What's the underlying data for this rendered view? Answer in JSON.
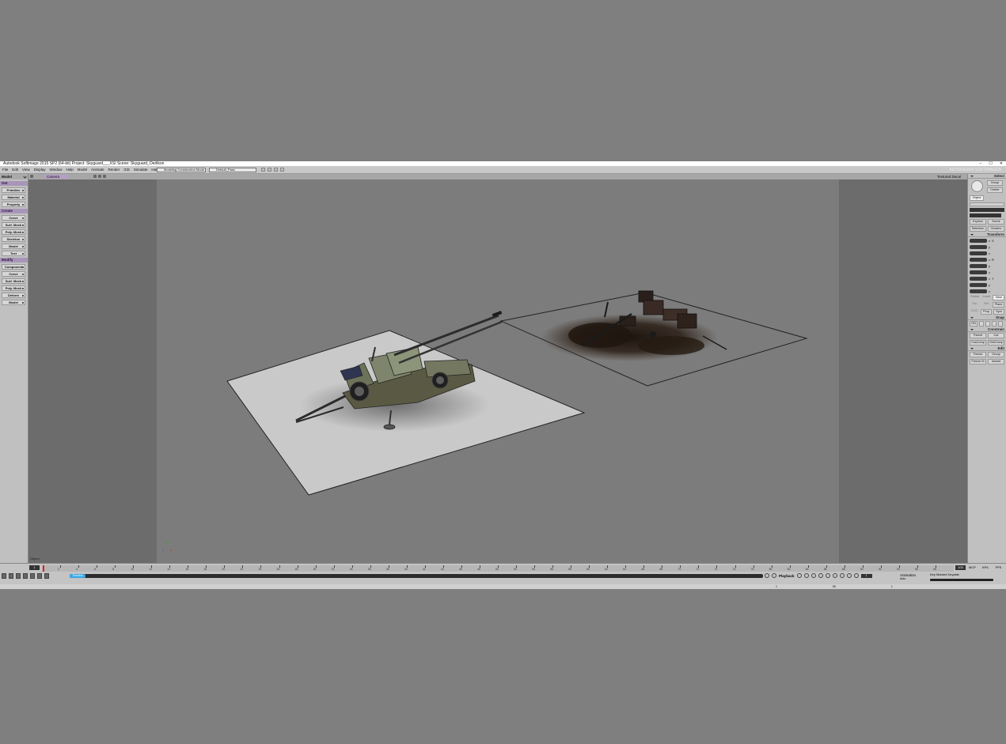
{
  "window": {
    "title": "Autodesk Softimage 2015 SP2 (64-bit)    Project: Skyguard___XSI    Scene: Skyguard_Oerlikon",
    "controls": [
      "–",
      "☐",
      "✕"
    ]
  },
  "menubar": {
    "menus": [
      "File",
      "Edit",
      "View",
      "Display",
      "Window",
      "Help",
      "Model",
      "Animate",
      "Render",
      "ICE",
      "Simulate",
      "Hair",
      "Face Robot"
    ],
    "construction_mode": "Modeling Construction Mode",
    "pass": "Default_Pass",
    "brand": "AUTODESK® SOFTIMAGE®"
  },
  "left_panel": {
    "module": "Model",
    "sections": [
      {
        "title": "Get",
        "buttons": [
          "Primitive",
          "Material",
          "Property"
        ]
      },
      {
        "title": "Create",
        "buttons": [
          "Curve",
          "Surf. Mesh",
          "Poly. Mesh",
          "Skeleton",
          "Model",
          "Text"
        ]
      },
      {
        "title": "Modify",
        "buttons": [
          "Component",
          "Curve",
          "Surf. Mesh",
          "Poly. Mesh",
          "Deform",
          "Model"
        ]
      }
    ]
  },
  "viewport": {
    "camera": "Camera",
    "shading": "Textured Decal",
    "axis": {
      "x": "x",
      "y": "y",
      "z": "z"
    },
    "bottom_label": "Object"
  },
  "right_panel": {
    "select_title": "Select",
    "group": "Group",
    "center": "Center",
    "object": "Object",
    "explore": "Explore",
    "scene": "Scene",
    "selection": "Selection",
    "clusters": "Clusters",
    "transform_title": "Transform",
    "transform_axes": [
      "x",
      "y",
      "z"
    ],
    "transform_icons": [
      "S",
      "R",
      "T"
    ],
    "global": "Global",
    "local": "Local",
    "view": "View",
    "par": "Par",
    "ref": "Ref",
    "plane": "Plane",
    "cog": "COG",
    "prop": "Prop",
    "sym": "Sym",
    "snap_title": "Snap",
    "snap_on": "ON",
    "constrain_title": "Constrain",
    "parent": "Parent",
    "cut": "Cut",
    "cnscomp": "CnsComp",
    "chldcomp": "ChldComp",
    "edit_title": "Edit",
    "freeze": "Freeze",
    "immed_group": "Group",
    "freeze_m": "Freeze M",
    "immed": "Immed"
  },
  "timeline": {
    "start_frame": "1",
    "end_frame": "100",
    "ticks": [
      "2",
      "4",
      "6",
      "8",
      "10",
      "12",
      "14",
      "16",
      "18",
      "20",
      "22",
      "24",
      "26",
      "28",
      "30",
      "32",
      "34",
      "36",
      "38",
      "40",
      "42",
      "44",
      "46",
      "48",
      "50",
      "52",
      "54",
      "56",
      "58",
      "60",
      "62",
      "64",
      "66",
      "68",
      "70",
      "72",
      "74",
      "76",
      "78",
      "80",
      "82",
      "84",
      "86",
      "88",
      "90",
      "92",
      "94",
      "96",
      "98"
    ],
    "current_frame": "1",
    "fps_labels": [
      "MCP",
      "KP/L",
      "FPS"
    ],
    "range_label": "Timeline",
    "playback": "Playback",
    "animation": "Animation",
    "auto": "Auto",
    "key_mode": "Key Marked Keyable",
    "current_time": "1",
    "mini_ticks": [
      "1",
      "50",
      "1"
    ]
  }
}
